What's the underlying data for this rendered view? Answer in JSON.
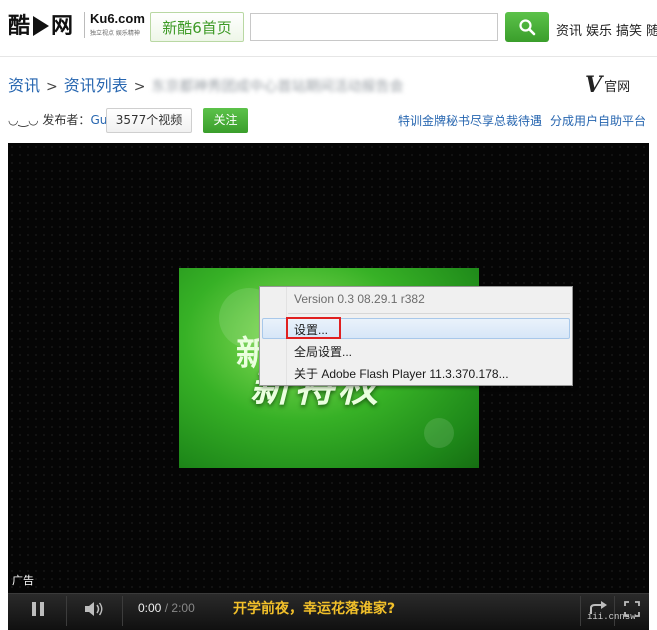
{
  "header": {
    "logo_cn_a": "酷",
    "logo_cn_b": "网",
    "logo_en": "Ku6.com",
    "logo_slogan": "独立视点 娱乐精神",
    "home_button": "新酷6首页",
    "search_value": "",
    "nav": [
      "资讯",
      "娱乐",
      "搞笑",
      "随创"
    ]
  },
  "breadcrumb": {
    "items": [
      "资讯",
      "资讯列表"
    ],
    "separator": ">",
    "current": "东京都神秀团成中心首站期间活动报告会"
  },
  "brand_badge": {
    "mark": "V",
    "label": "官网"
  },
  "publisher": {
    "label": "发布者：",
    "name": "Gu",
    "video_count": "3577个视频",
    "follow": "关注"
  },
  "promo_links": [
    "特训金牌秘书尽享总裁待遇",
    "分成用户自助平台"
  ],
  "player": {
    "splash_char": "新",
    "splash_text": "新特权",
    "ad_label": "广告",
    "time_current": "0:00",
    "time_sep": "/",
    "time_total": "2:00",
    "ticker": "开学前夜，幸运花落谁家?",
    "watermark": "iii.cnnsw"
  },
  "context_menu": {
    "version": "Version 0.3 08.29.1 r382",
    "items": [
      "设置...",
      "全局设置...",
      "关于 Adobe Flash Player 11.3.370.178..."
    ]
  },
  "colors": {
    "accent_green": "#3a9e2b",
    "link_blue": "#2766b0",
    "highlight_red": "#e02020",
    "ticker_yellow": "#f2c02a"
  }
}
